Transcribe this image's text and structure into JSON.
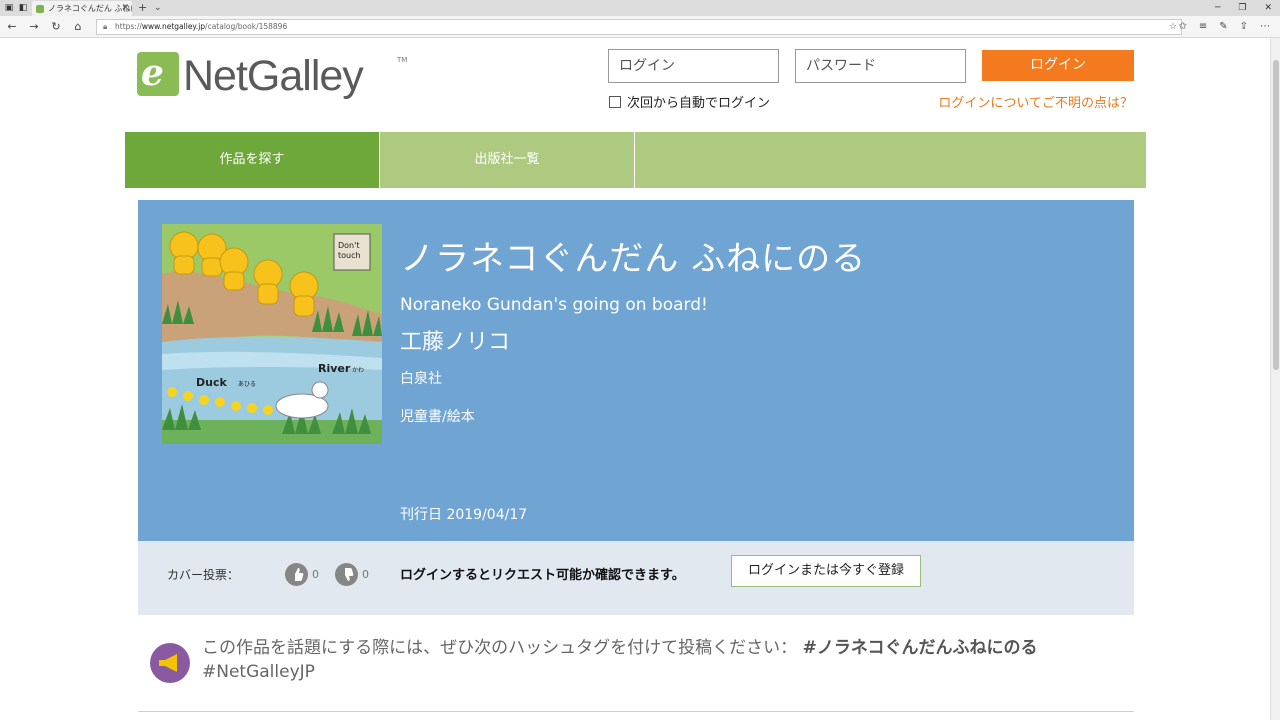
{
  "browser": {
    "tab_title": "ノラネコぐんだん ふねにのる",
    "url_prefix": "https://",
    "url_domain": "www.netgalley.jp",
    "url_path": "/catalog/book/158896"
  },
  "header": {
    "logo_text": "NetGalley",
    "logo_tm": "TM",
    "login_placeholder": "ログイン",
    "password_placeholder": "パスワード",
    "login_button": "ログイン",
    "remember_label": "次回から自動でログイン",
    "help_link": "ログインについてご不明の点は？"
  },
  "nav": {
    "items": [
      {
        "label": "作品を探す"
      },
      {
        "label": "出版社一覧"
      }
    ]
  },
  "book": {
    "title": "ノラネコぐんだん ふねにのる",
    "subtitle": "Noraneko Gundan's going on board!",
    "author": "工藤ノリコ",
    "publisher": "白泉社",
    "category": "児童書/絵本",
    "pubdate_label": "刊行日",
    "pubdate": "2019/04/17",
    "cover_texts": {
      "sign_line1": "Don't",
      "sign_line2": "touch",
      "river": "River",
      "river_kana": "かわ",
      "duck": "Duck",
      "duck_kana": "あひる"
    }
  },
  "actions": {
    "vote_label": "カバー投票：",
    "up_count": "0",
    "down_count": "0",
    "request_message": "ログインするとリクエスト可能か確認できます。",
    "register_button": "ログインまたは今すぐ登録"
  },
  "hashtag": {
    "text": "この作品を話題にする際には、ぜひ次のハッシュタグを付けて投稿ください：",
    "tag1": "#ノラネコぐんだんふねにのる",
    "tag2": "#NetGalleyJP"
  },
  "colors": {
    "accent_orange": "#f47a20",
    "nav_green": "#6fa83a",
    "nav_light_green": "#aeca81",
    "hero_blue": "#70a4d2",
    "action_bar": "#e1e8ef"
  }
}
